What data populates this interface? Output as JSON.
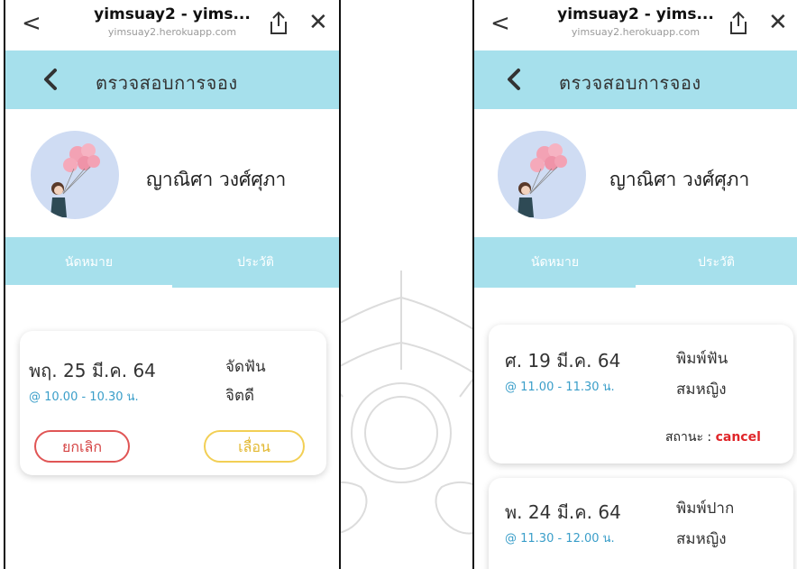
{
  "browser": {
    "title": "yimsuay2 - yims...",
    "url": "yimsuay2.herokuapp.com",
    "back_glyph": "<",
    "close_glyph": "✕"
  },
  "header": {
    "back_glyph": "<",
    "title": "ตรวจสอบการจอง"
  },
  "profile": {
    "name": "ญาณิศา วงศ์ศุภา"
  },
  "tabs": {
    "appointments": "นัดหมาย",
    "history": "ประวัติ"
  },
  "left_screen": {
    "active_tab": "appointments",
    "appointment": {
      "date": "พฤ. 25 มี.ค. 64",
      "time": "@ 10.00 - 10.30 น.",
      "service": "จัดฟัน",
      "doctor": "จิตดี",
      "cancel_label": "ยกเลิก",
      "postpone_label": "เลื่อน"
    }
  },
  "right_screen": {
    "active_tab": "history",
    "history": [
      {
        "date": "ศ. 19 มี.ค. 64",
        "time": "@ 11.00 - 11.30 น.",
        "service": "พิมพ์ฟัน",
        "doctor": "สมหญิง",
        "status_label": "สถานะ :",
        "status_value": "cancel"
      },
      {
        "date": "พ. 24 มี.ค. 64",
        "time": "@ 11.30 - 12.00 น.",
        "service": "พิมพ์ปาก",
        "doctor": "สมหญิง"
      }
    ]
  },
  "colors": {
    "header_bg": "#a6e0ec",
    "time_text": "#3a9ec9",
    "cancel_red": "#e05555",
    "postpone_yellow": "#f2cf55",
    "status_red": "#e0262a"
  }
}
